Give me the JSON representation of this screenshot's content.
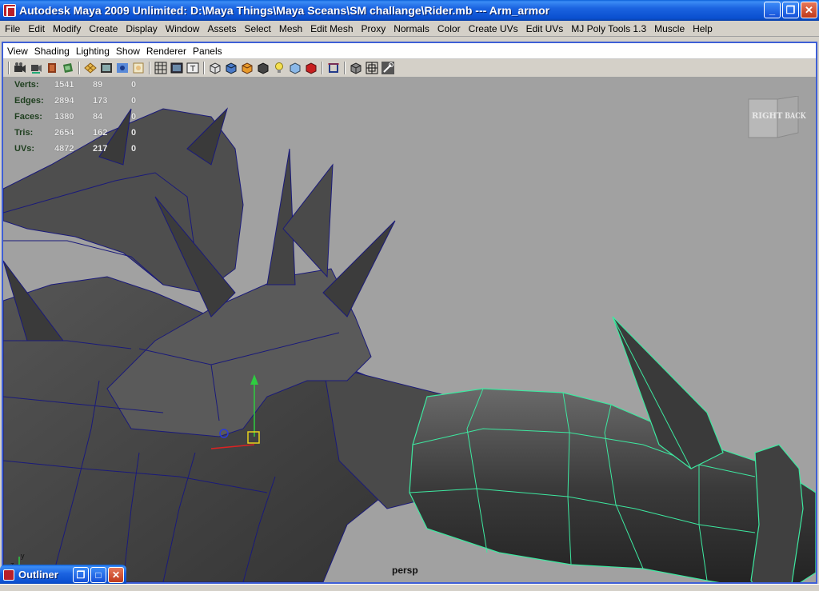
{
  "window": {
    "title": "Autodesk Maya 2009 Unlimited: D:\\Maya Things\\Maya Sceans\\SM challange\\Rider.mb   ---   Arm_armor",
    "minimize_glyph": "_",
    "maximize_glyph": "❐",
    "close_glyph": "✕"
  },
  "main_menu": [
    "File",
    "Edit",
    "Modify",
    "Create",
    "Display",
    "Window",
    "Assets",
    "Select",
    "Mesh",
    "Edit Mesh",
    "Proxy",
    "Normals",
    "Color",
    "Create UVs",
    "Edit UVs",
    "MJ Poly Tools 1.3",
    "Muscle",
    "Help"
  ],
  "panel_menu": [
    "View",
    "Shading",
    "Lighting",
    "Show",
    "Renderer",
    "Panels"
  ],
  "toolbar_icons": [
    "camera-icon",
    "camera-attributes-icon",
    "bookmark-icon",
    "image-plane-icon",
    "grid-icon",
    "film-gate-icon",
    "resolution-gate-icon",
    "safe-area-icon",
    "wireframe-icon",
    "smooth-shade-icon",
    "textured-icon",
    "lights-icon",
    "shadows-icon",
    "xray-icon",
    "isolate-select-icon",
    "hud-icon",
    "snapshot-icon"
  ],
  "hud": {
    "rows": [
      {
        "label": "Verts:",
        "a": "1541",
        "b": "89",
        "c": "0"
      },
      {
        "label": "Edges:",
        "a": "2894",
        "b": "173",
        "c": "0"
      },
      {
        "label": "Faces:",
        "a": "1380",
        "b": "84",
        "c": "0"
      },
      {
        "label": "Tris:",
        "a": "2654",
        "b": "162",
        "c": "0"
      },
      {
        "label": "UVs:",
        "a": "4872",
        "b": "217",
        "c": "0"
      }
    ]
  },
  "viewcube": {
    "right": "RIGHT",
    "back": "BACK"
  },
  "camera": "persp",
  "axis": {
    "x": "x",
    "y": "y",
    "z": "z"
  },
  "outliner": {
    "title": "Outliner",
    "restore_glyph": "❐",
    "maximize_glyph": "□",
    "close_glyph": "✕"
  },
  "colors": {
    "titlebar": "#0a4fcf",
    "selection_wire": "#3de8a0",
    "mesh_wire": "#1a1a7a",
    "viewport_bg": "#a1a1a1"
  }
}
